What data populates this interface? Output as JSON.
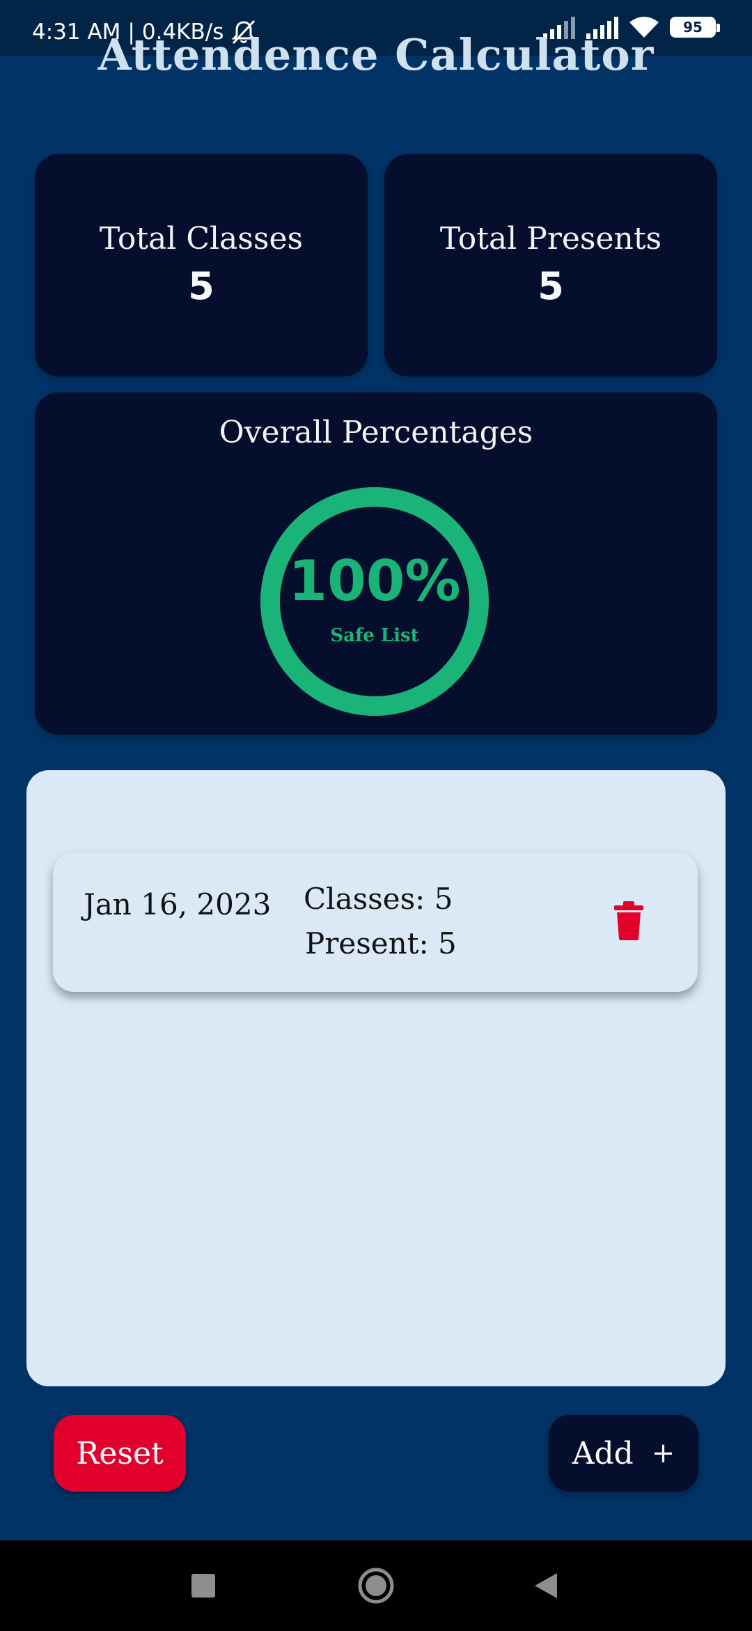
{
  "status_bar": {
    "time": "4:31 AM",
    "speed": "0.4KB/s",
    "battery": "95"
  },
  "app": {
    "title": "Attendence Calculator"
  },
  "stats": {
    "total_classes_label": "Total Classes",
    "total_classes_value": "5",
    "total_presents_label": "Total Presents",
    "total_presents_value": "5"
  },
  "overall": {
    "label": "Overall Percentages",
    "percent_text": "100%",
    "percent_value": 100,
    "status": "Safe List",
    "ring_color": "#1bb478"
  },
  "entries": [
    {
      "date": "Jan 16, 2023",
      "classes": "Classes: 5",
      "present": "Present: 5",
      "icon": "trash-icon"
    }
  ],
  "buttons": {
    "reset": "Reset",
    "add": "Add",
    "add_icon": "+"
  },
  "colors": {
    "background": "#023366",
    "card": "#050e2c",
    "panel": "#dbe9f7",
    "danger": "#e2002d",
    "success": "#1bb478"
  }
}
